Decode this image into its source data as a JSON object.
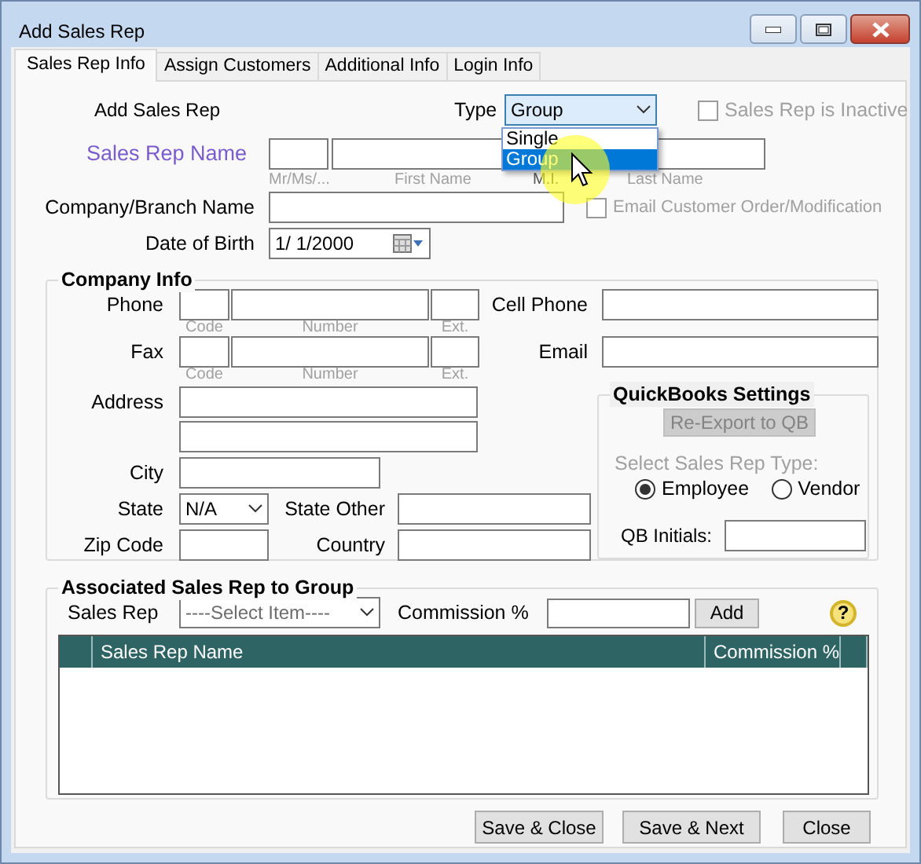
{
  "window": {
    "title": "Add Sales Rep"
  },
  "tabs": [
    {
      "label": "Sales Rep Info",
      "selected": true
    },
    {
      "label": "Assign Customers",
      "selected": false
    },
    {
      "label": "Additional Info",
      "selected": false
    },
    {
      "label": "Login Info",
      "selected": false
    }
  ],
  "header": {
    "label": "Add Sales Rep",
    "type_label": "Type",
    "type_value": "Group",
    "expanded": true,
    "type_options": [
      {
        "label": "Single",
        "selected": false
      },
      {
        "label": "Group",
        "selected": true
      }
    ],
    "inactive": {
      "label": "Sales Rep is Inactive",
      "checked": false,
      "disabled": true
    }
  },
  "name": {
    "label": "Sales Rep Name",
    "hints": [
      "Mr/Ms/...",
      "First Name",
      "M.I.",
      "Last Name"
    ]
  },
  "company": {
    "label": "Company/Branch Name",
    "email_option": {
      "label": "Email Customer Order/Modification",
      "checked": false,
      "disabled": true
    }
  },
  "birth": {
    "label": "Date of Birth",
    "value": "1/ 1/2000"
  },
  "company_info": {
    "title": "Company Info",
    "phone": {
      "label": "Phone",
      "hints": [
        "Code",
        "Number",
        "Ext."
      ]
    },
    "cell_phone": "Cell Phone",
    "fax": {
      "label": "Fax",
      "hints": [
        "Code",
        "Number",
        "Ext."
      ]
    },
    "email": "Email",
    "address": "Address",
    "city": "City",
    "state": {
      "label": "State",
      "value": "N/A"
    },
    "state_other": "State Other",
    "zip": "Zip Code",
    "country": "Country"
  },
  "quickbooks": {
    "title": "QuickBooks Settings",
    "button": {
      "label": "Re-Export to QB",
      "disabled": true
    },
    "type_label": "Select Sales Rep Type:",
    "types": [
      {
        "label": "Employee",
        "selected": true
      },
      {
        "label": "Vendor",
        "selected": false
      }
    ],
    "initials_label": "QB Initials:"
  },
  "association": {
    "title": "Associated Sales Rep to Group",
    "rep_label": "Sales Rep",
    "rep_value": "----Select Item----",
    "commission_label": "Commission %",
    "add_button": "Add",
    "help": "?",
    "table": {
      "columns": [
        "Sales Rep Name",
        "Commission %"
      ]
    }
  },
  "buttons": [
    "Save & Close",
    "Save & Next",
    "Close"
  ]
}
